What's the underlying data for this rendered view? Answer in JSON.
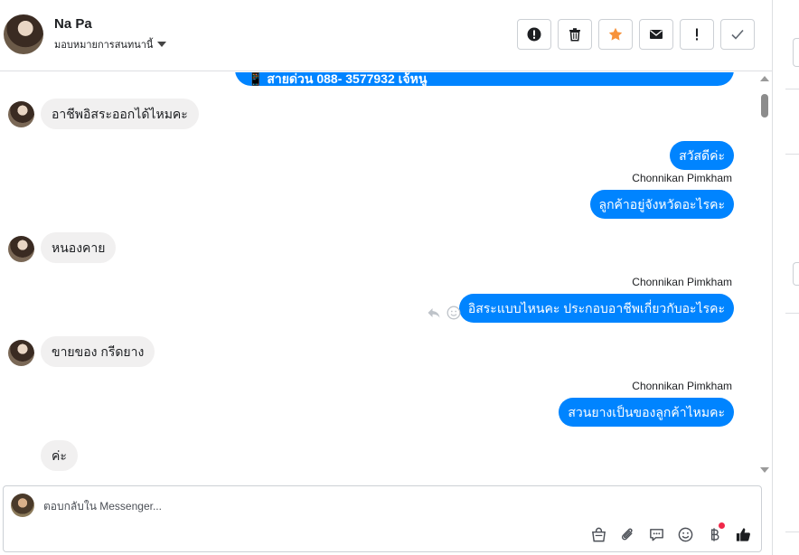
{
  "header": {
    "contact_name": "Na Pa",
    "assign_label": "มอบหมายการสนทนานี้"
  },
  "actions": [
    {
      "icon": "alert-circle-icon",
      "color": "#1c1e21"
    },
    {
      "icon": "trash-icon",
      "color": "#1c1e21"
    },
    {
      "icon": "star-icon",
      "color": "#f7923b"
    },
    {
      "icon": "envelope-icon",
      "color": "#1c1e21"
    },
    {
      "icon": "exclamation-icon",
      "color": "#1c1e21"
    },
    {
      "icon": "check-icon",
      "color": "#1c1e21"
    }
  ],
  "messages": {
    "pinned_partial": "📱 สายด่วน 088- 3577932 เจ้หนู",
    "items": [
      {
        "direction": "in",
        "text": "อาชีพอิสระออกได้ไหมคะ"
      },
      {
        "direction": "out",
        "text": "สวัสดีค่ะ"
      },
      {
        "direction": "out",
        "sender": "Chonnikan Pimkham",
        "text": "ลูกค้าอยู่จังหวัดอะไรคะ"
      },
      {
        "direction": "in",
        "text": "หนองคาย"
      },
      {
        "direction": "out",
        "sender": "Chonnikan Pimkham",
        "text": "อิสระแบบไหนคะ ประกอบอาชีพเกี่ยวกับอะไรคะ"
      },
      {
        "direction": "in",
        "text": "ขายของ กรีดยาง"
      },
      {
        "direction": "out",
        "sender": "Chonnikan Pimkham",
        "text": "สวนยางเป็นของลูกค้าไหมคะ"
      },
      {
        "direction": "in",
        "text": "ค่ะ"
      }
    ]
  },
  "composer": {
    "placeholder": "ตอบกลับใน Messenger...",
    "tools": [
      "bag-icon",
      "paperclip-icon",
      "chat-bubble-icon",
      "smiley-icon",
      "baht-icon",
      "thumbs-up-icon"
    ]
  },
  "colors": {
    "outgoing_bubble": "#0084ff",
    "incoming_bubble": "#f1f0f0",
    "star": "#f7923b",
    "notification_dot": "#f02849"
  }
}
